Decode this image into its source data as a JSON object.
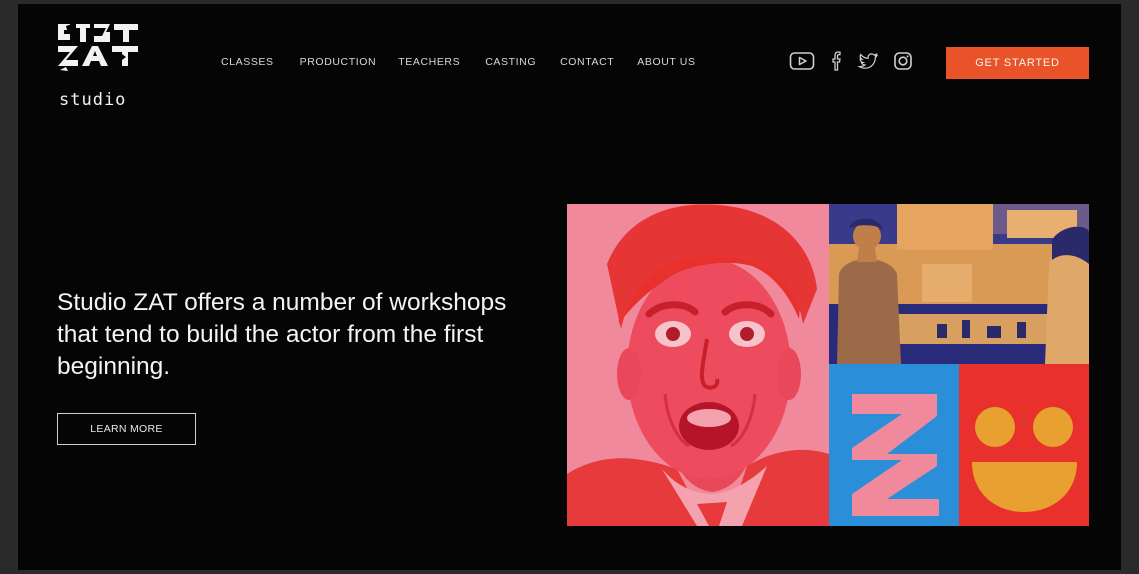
{
  "brand": {
    "logo_word": "studio"
  },
  "nav": {
    "items": [
      "CLASSES",
      "PRODUCTION",
      "TEACHERS",
      "CASTING",
      "CONTACT",
      "ABOUT US"
    ]
  },
  "social": {
    "icons": [
      "youtube-icon",
      "facebook-icon",
      "twitter-icon",
      "instagram-icon"
    ]
  },
  "header": {
    "cta_label": "GET STARTED"
  },
  "hero": {
    "headline": "Studio ZAT offers a number of workshops that tend to build the actor from the first beginning.",
    "button_label": "LEARN MORE"
  },
  "colors": {
    "background": "#050505",
    "accent": "#e8532a",
    "pink": "#f0899c",
    "red": "#e8312c",
    "blue": "#2a8fd8",
    "orange": "#e8a030",
    "navy": "#1c2a8a"
  }
}
